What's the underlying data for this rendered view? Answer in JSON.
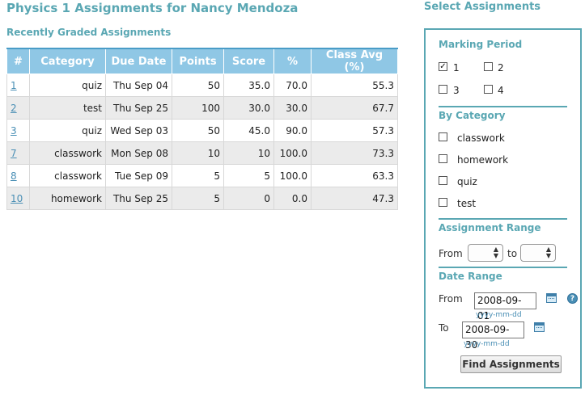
{
  "header": {
    "title": "Physics 1 Assignments for Nancy Mendoza",
    "subtitle": "Recently Graded Assignments"
  },
  "table": {
    "columns": [
      "#",
      "Category",
      "Due Date",
      "Points",
      "Score",
      "%",
      "Class Avg (%)"
    ],
    "rows": [
      {
        "num": "1",
        "category": "quiz",
        "due": "Thu Sep 04",
        "points": "50",
        "score": "35.0",
        "pct": "70.0",
        "avg": "55.3"
      },
      {
        "num": "2",
        "category": "test",
        "due": "Thu Sep 25",
        "points": "100",
        "score": "30.0",
        "pct": "30.0",
        "avg": "67.7"
      },
      {
        "num": "3",
        "category": "quiz",
        "due": "Wed Sep 03",
        "points": "50",
        "score": "45.0",
        "pct": "90.0",
        "avg": "57.3"
      },
      {
        "num": "7",
        "category": "classwork",
        "due": "Mon Sep 08",
        "points": "10",
        "score": "10",
        "pct": "100.0",
        "avg": "73.3"
      },
      {
        "num": "8",
        "category": "classwork",
        "due": "Tue Sep 09",
        "points": "5",
        "score": "5",
        "pct": "100.0",
        "avg": "63.3"
      },
      {
        "num": "10",
        "category": "homework",
        "due": "Thu Sep 25",
        "points": "5",
        "score": "0",
        "pct": "0.0",
        "avg": "47.3"
      }
    ]
  },
  "panel": {
    "heading": "Select Assignments",
    "marking_period": {
      "title": "Marking Period",
      "options": [
        {
          "label": "1",
          "checked": true
        },
        {
          "label": "2",
          "checked": false
        },
        {
          "label": "3",
          "checked": false
        },
        {
          "label": "4",
          "checked": false
        }
      ]
    },
    "category": {
      "title": "By Category",
      "options": [
        {
          "label": "classwork",
          "checked": false
        },
        {
          "label": "homework",
          "checked": false
        },
        {
          "label": "quiz",
          "checked": false
        },
        {
          "label": "test",
          "checked": false
        }
      ]
    },
    "assignment_range": {
      "title": "Assignment Range",
      "from_label": "From",
      "to_label": "to",
      "from_value": "",
      "to_value": ""
    },
    "date_range": {
      "title": "Date Range",
      "from_label": "From",
      "from_value": "2008-09-01",
      "to_label": "To",
      "to_value": "2008-09-30",
      "format_hint": "yyyy-mm-dd",
      "help_glyph": "?"
    },
    "submit_label": "Find Assignments",
    "check_glyph": "✓"
  },
  "colors": {
    "accent": "#5aa7b3",
    "table_header": "#8fc7e5",
    "row_alt": "#ebebeb",
    "link": "#4a8fb5"
  },
  "icons": [
    "checkbox-icon",
    "calendar-icon",
    "help-icon",
    "select-arrows-icon"
  ]
}
